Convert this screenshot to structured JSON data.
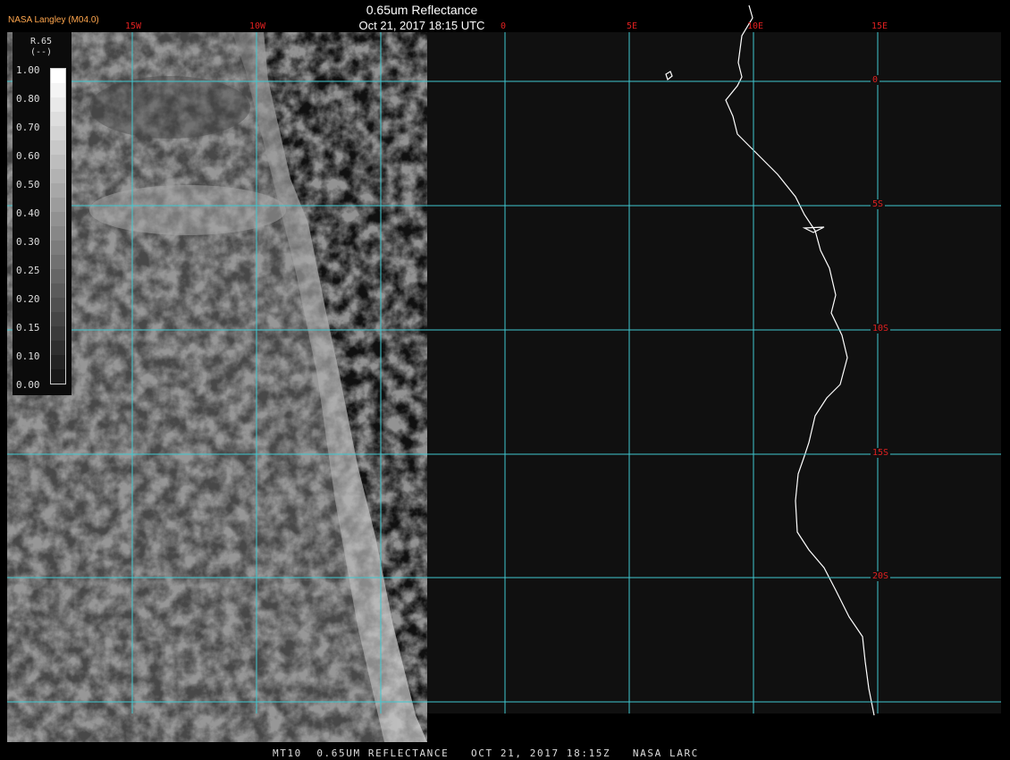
{
  "header": {
    "agency": "NASA Langley (M04.0)",
    "title": "0.65um Reflectance",
    "datetime": "Oct 21, 2017 18:15 UTC"
  },
  "footer": {
    "text": "MT10  0.65UM REFLECTANCE   OCT 21, 2017 18:15Z   NASA LARC"
  },
  "legend": {
    "name": "R.65",
    "units": "(--)",
    "labels": [
      "1.00",
      "0.80",
      "0.70",
      "0.60",
      "0.50",
      "0.40",
      "0.30",
      "0.25",
      "0.20",
      "0.15",
      "0.10",
      "0.00"
    ]
  },
  "grid": {
    "longitudes": [
      "15W",
      "10W",
      "0",
      "5E",
      "10E",
      "15E"
    ],
    "latitudes": [
      "0",
      "5S",
      "10S",
      "15S",
      "20S"
    ]
  },
  "colors": {
    "grid_line": "#40c8d0",
    "label": "#e02020",
    "ocean": "#101010",
    "coastline": "#ffffff"
  }
}
